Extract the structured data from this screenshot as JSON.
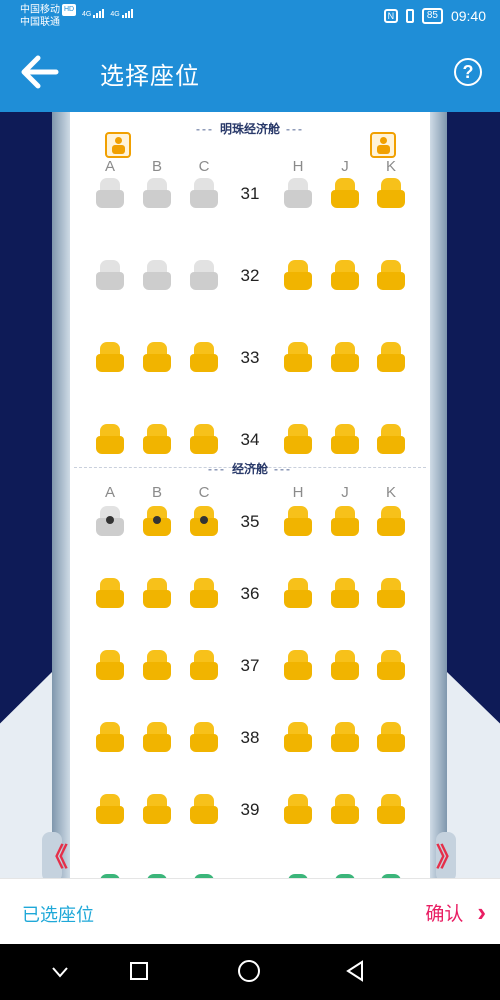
{
  "status_bar": {
    "carrier1": "中国移动",
    "carrier1_badge": "HD",
    "carrier2": "中国联通",
    "network1": "4G",
    "network2": "4G",
    "battery": "85",
    "time": "09:40"
  },
  "header": {
    "title": "选择座位",
    "back_icon": "arrow-left-icon",
    "help_icon": "question-icon",
    "help_text": "?"
  },
  "cabin": {
    "sections": [
      {
        "name": "明珠经济舱"
      },
      {
        "name": "经济舱"
      }
    ],
    "columns": [
      "A",
      "B",
      "C",
      "H",
      "J",
      "K"
    ],
    "rows": [
      {
        "number": "31",
        "seats": [
          "taken",
          "taken",
          "taken",
          "taken",
          "available",
          "available"
        ]
      },
      {
        "number": "32",
        "seats": [
          "taken",
          "taken",
          "taken",
          "available",
          "available",
          "available"
        ]
      },
      {
        "number": "33",
        "seats": [
          "available",
          "available",
          "available",
          "available",
          "available",
          "available"
        ]
      },
      {
        "number": "34",
        "seats": [
          "available",
          "available",
          "available",
          "available",
          "available",
          "available"
        ]
      },
      {
        "number": "35",
        "seats": [
          "taken",
          "available",
          "available",
          "available",
          "available",
          "available"
        ]
      },
      {
        "number": "36",
        "seats": [
          "available",
          "available",
          "available",
          "available",
          "available",
          "available"
        ]
      },
      {
        "number": "37",
        "seats": [
          "available",
          "available",
          "available",
          "available",
          "available",
          "available"
        ]
      },
      {
        "number": "38",
        "seats": [
          "available",
          "available",
          "available",
          "available",
          "available",
          "available"
        ]
      },
      {
        "number": "39",
        "seats": [
          "available",
          "available",
          "available",
          "available",
          "available",
          "available"
        ]
      },
      {
        "number": "",
        "seats": [
          "green",
          "green",
          "green",
          "green",
          "green",
          "green"
        ]
      }
    ],
    "infant_icons": [
      "infant-icon",
      "infant-icon"
    ],
    "exit_markers": [
      "《",
      "》"
    ]
  },
  "footer": {
    "selected_label": "已选座位",
    "confirm_label": "确认",
    "confirm_icon": "chevron-right-icon",
    "confirm_chevron": "›"
  },
  "nav": {
    "back": "nav-back-icon",
    "home": "nav-home-icon",
    "recent": "nav-recents-icon"
  },
  "colors": {
    "primary": "#1f8ed7",
    "seat_available": "#f1b400",
    "seat_taken": "#cdcdcd",
    "seat_green": "#2fa56b",
    "confirm": "#e91e63",
    "selected_label": "#1fa8d8",
    "cabin_bg": "#0e1b57"
  }
}
